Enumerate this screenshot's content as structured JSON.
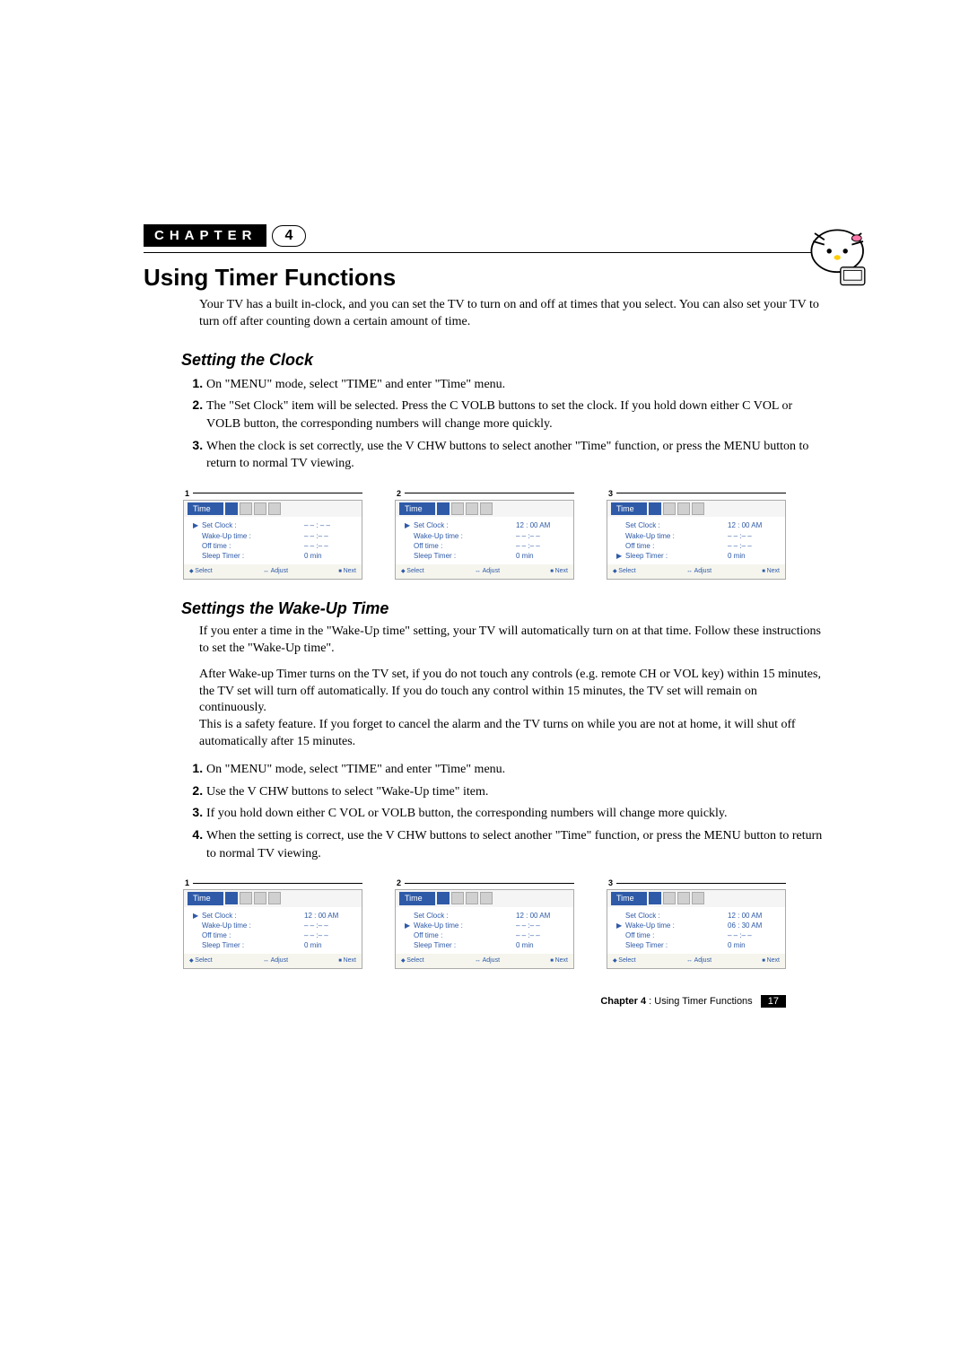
{
  "chapter": {
    "label": "CHAPTER",
    "num": "4"
  },
  "title": "Using Timer Functions",
  "intro": "Your TV has a built in-clock, and you can set the TV to turn on and off at times that you select. You can also set your TV to turn off after counting down a certain amount of time.",
  "section1": {
    "heading": "Setting the Clock",
    "steps": [
      "On \"MENU\" mode, select \"TIME\" and enter \"Time\" menu.",
      "The \"Set Clock\" item will be selected. Press the C VOLB  buttons to set the clock. If you hold down either C VOL or VOLB  button, the corresponding numbers will change more quickly.",
      "When the clock is set correctly, use the V CHW buttons to select another \"Time\" function, or press the MENU button to return to normal TV viewing."
    ]
  },
  "osd1": [
    {
      "num": "1",
      "selected": 0,
      "setClock": "– – : – –",
      "wake": "– – :– –",
      "off": "– – :– –",
      "sleep": "0 min"
    },
    {
      "num": "2",
      "selected": 0,
      "setClock": "12 : 00 AM",
      "wake": "– – :– –",
      "off": "– – :– –",
      "sleep": "0 min"
    },
    {
      "num": "3",
      "selected": 3,
      "setClock": "12 : 00 AM",
      "wake": "– – :– –",
      "off": "– – :– –",
      "sleep": "0 min"
    }
  ],
  "section2": {
    "heading": "Settings the Wake-Up Time",
    "p1": "If you enter a time in the \"Wake-Up time\" setting, your TV will automatically turn on at that time. Follow these instructions to set the \"Wake-Up time\".",
    "p2": "After Wake-up Timer turns on the TV set, if you do not touch any controls (e.g. remote CH or VOL key) within 15 minutes, the TV set will turn off automatically. If you do touch any control within 15 minutes, the TV set will remain on continuously.",
    "p3": "This is a safety feature. If you forget to cancel the alarm and the TV turns on while you are not at home, it will shut off automatically after 15 minutes.",
    "steps": [
      "On \"MENU\" mode, select \"TIME\" and enter \"Time\" menu.",
      "Use the V CHW buttons to select \"Wake-Up time\" item.",
      "If you hold down either C VOL or VOLB  button, the corresponding numbers will change more quickly.",
      "When the setting is correct, use the V CHW buttons to select another \"Time\" function, or press the MENU button to return to normal TV viewing."
    ]
  },
  "osd2": [
    {
      "num": "1",
      "selected": 0,
      "setClock": "12 : 00 AM",
      "wake": "– – :– –",
      "off": "– – :– –",
      "sleep": "0 min"
    },
    {
      "num": "2",
      "selected": 1,
      "setClock": "12 : 00 AM",
      "wake": "– – :– –",
      "off": "– – :– –",
      "sleep": "0 min"
    },
    {
      "num": "3",
      "selected": 1,
      "setClock": "12 : 00 AM",
      "wake": "06 : 30 AM",
      "off": "– – :– –",
      "sleep": "0 min"
    }
  ],
  "osdLabels": {
    "title": "Time",
    "setClock": "Set Clock :",
    "wake": "Wake-Up time :",
    "off": "Off time :",
    "sleep": "Sleep Timer :",
    "select": "Select",
    "adjust": "Adjust",
    "next": "Next"
  },
  "footer": {
    "chapter": "Chapter 4",
    "title": ": Using Timer Functions",
    "page": "17"
  }
}
